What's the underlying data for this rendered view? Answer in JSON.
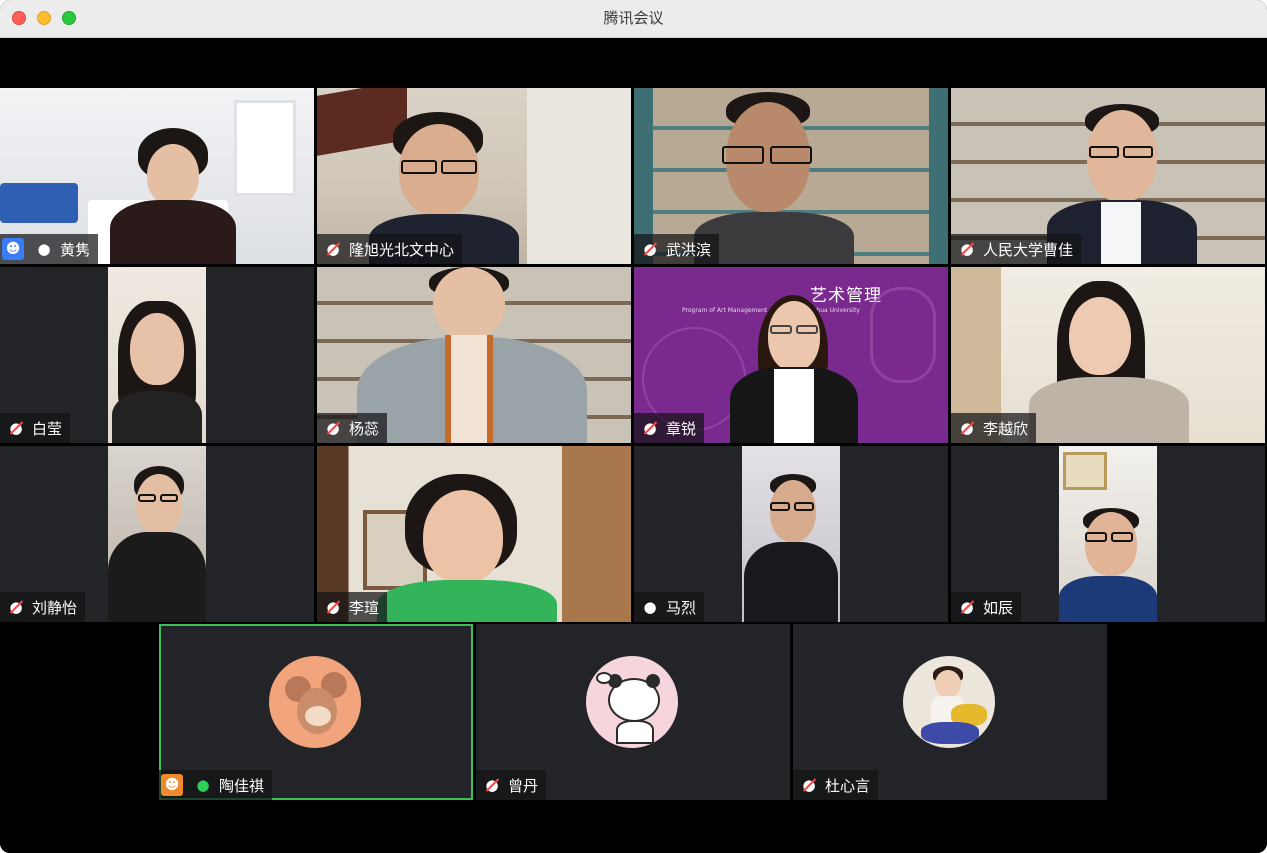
{
  "window": {
    "title": "腾讯会议",
    "controls": [
      "close",
      "minimize",
      "maximize"
    ]
  },
  "colors": {
    "speaker_border": "#3cc05a",
    "muted_red": "#ff4444",
    "host_blue": "#3a7cf5",
    "host_orange": "#f08a2f",
    "tile_bg": "#232427"
  },
  "participants": [
    {
      "name": "黄隽",
      "mic": "on",
      "host": "blue",
      "video": true
    },
    {
      "name": "隆旭光北文中心",
      "mic": "muted",
      "video": true
    },
    {
      "name": "武洪滨",
      "mic": "muted",
      "video": true
    },
    {
      "name": "人民大学曹佳",
      "mic": "muted",
      "video": true
    },
    {
      "name": "白莹",
      "mic": "muted",
      "video": true
    },
    {
      "name": "杨蕊",
      "mic": "muted",
      "video": true
    },
    {
      "name": "章锐",
      "mic": "muted",
      "video": true,
      "backdrop_text": "艺术管理",
      "backdrop_sub": "Program of Art Management ... Design, Tsinghua University"
    },
    {
      "name": "李越欣",
      "mic": "muted",
      "video": true
    },
    {
      "name": "刘静怡",
      "mic": "muted",
      "video": true
    },
    {
      "name": "李瑄",
      "mic": "muted",
      "video": true
    },
    {
      "name": "马烈",
      "mic": "on",
      "video": true
    },
    {
      "name": "如辰",
      "mic": "muted",
      "video": true
    },
    {
      "name": "陶佳祺",
      "mic": "active",
      "host": "orange",
      "video": false,
      "avatar": "mouse-avatar",
      "speaking": true
    },
    {
      "name": "曾丹",
      "mic": "muted",
      "video": false,
      "avatar": "panda-avatar"
    },
    {
      "name": "杜心言",
      "mic": "muted",
      "video": false,
      "avatar": "child-avatar"
    }
  ]
}
